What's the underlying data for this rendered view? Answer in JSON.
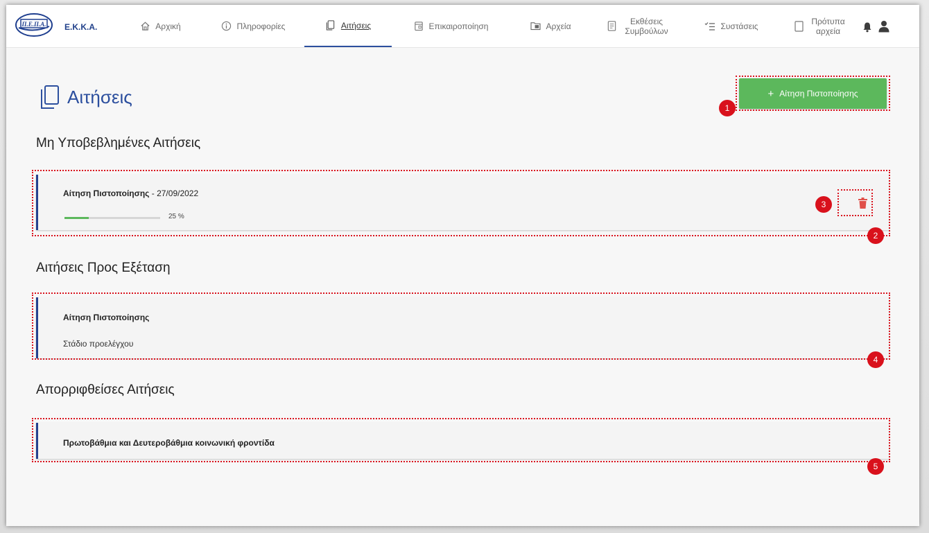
{
  "brand": {
    "logo_text": "Π.Ε.Π.Α.",
    "name": "Ε.Κ.Κ.Α."
  },
  "nav": {
    "items": [
      {
        "label": "Αρχική",
        "icon": "home-icon"
      },
      {
        "label": "Πληροφορίες",
        "icon": "info-icon"
      },
      {
        "label": "Αιτήσεις",
        "icon": "documents-icon",
        "active": true
      },
      {
        "label": "Επικαιροποίηση",
        "icon": "calendar-icon"
      },
      {
        "label": "Αρχεία",
        "icon": "folder-icon"
      },
      {
        "label": "Εκθέσεις Συμβούλων",
        "icon": "report-icon"
      },
      {
        "label": "Συστάσεις",
        "icon": "checklist-icon"
      },
      {
        "label": "Πρότυπα αρχεία",
        "icon": "file-icon"
      }
    ],
    "bell_icon": "bell-icon",
    "user_icon": "user-icon"
  },
  "page": {
    "title": "Αιτήσεις",
    "add_button_label": "Αίτηση Πιστοποίησης"
  },
  "sections": {
    "unsubmitted": {
      "title": "Μη Υποβεβλημένες Αιτήσεις",
      "card": {
        "name": "Αίτηση Πιστοποίησης",
        "date": " - 27/09/2022",
        "progress_percent": 25,
        "progress_label": "25 %"
      }
    },
    "under_review": {
      "title": "Αιτήσεις Προς Εξέταση",
      "card": {
        "name": "Αίτηση Πιστοποίησης",
        "stage": "Στάδιο προελέγχου"
      }
    },
    "rejected": {
      "title": "Απορριφθείσες Αιτήσεις",
      "card": {
        "name": "Πρωτοβάθμια και Δευτεροβάθμια κοινωνική φροντίδα"
      }
    }
  },
  "markers": [
    "1",
    "2",
    "3",
    "4",
    "5"
  ],
  "colors": {
    "accent": "#2c4f9e",
    "success": "#5cb85c",
    "danger": "#e0504a",
    "annotation": "#d9111c"
  }
}
